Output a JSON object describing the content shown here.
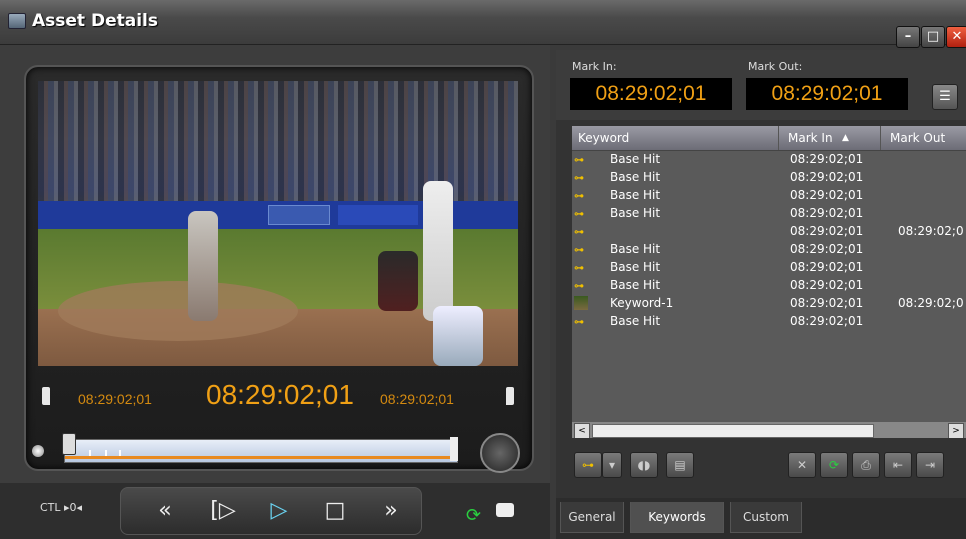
{
  "window": {
    "title": "Asset Details"
  },
  "player": {
    "tc_in": "08:29:02;01",
    "tc_current": "08:29:02;01",
    "tc_out": "08:29:02;01",
    "ctl_label": "CTL ▸0◂"
  },
  "mark": {
    "in_label": "Mark In:",
    "in_value": "08:29:02;01",
    "out_label": "Mark Out:",
    "out_value": "08:29:02;01"
  },
  "grid": {
    "columns": [
      "Keyword",
      "Mark In",
      "Mark Out"
    ],
    "sort_arrow": "▲",
    "rows": [
      {
        "keyword": "Base Hit",
        "mark_in": "08:29:02;01",
        "mark_out": "",
        "icon": "key-icon"
      },
      {
        "keyword": "Base Hit",
        "mark_in": "08:29:02;01",
        "mark_out": "",
        "icon": "key-icon"
      },
      {
        "keyword": "Base Hit",
        "mark_in": "08:29:02;01",
        "mark_out": "",
        "icon": "key-icon"
      },
      {
        "keyword": "Base Hit",
        "mark_in": "08:29:02;01",
        "mark_out": "",
        "icon": "key-icon"
      },
      {
        "keyword": "",
        "mark_in": "08:29:02;01",
        "mark_out": "08:29:02;0",
        "icon": "key-icon"
      },
      {
        "keyword": "Base Hit",
        "mark_in": "08:29:02;01",
        "mark_out": "",
        "icon": "key-icon"
      },
      {
        "keyword": "Base Hit",
        "mark_in": "08:29:02;01",
        "mark_out": "",
        "icon": "key-icon"
      },
      {
        "keyword": "Base Hit",
        "mark_in": "08:29:02;01",
        "mark_out": "",
        "icon": "key-icon"
      },
      {
        "keyword": "Keyword-1",
        "mark_in": "08:29:02;01",
        "mark_out": "08:29:02;0",
        "icon": "thumbnail-icon"
      },
      {
        "keyword": "Base Hit",
        "mark_in": "08:29:02;01",
        "mark_out": "",
        "icon": "key-icon"
      }
    ]
  },
  "tabs": [
    "General",
    "Keywords",
    "Custom"
  ],
  "colors": {
    "timecode": "#f0a015",
    "accent_play": "#6ad2f0",
    "green": "#2ad040"
  }
}
